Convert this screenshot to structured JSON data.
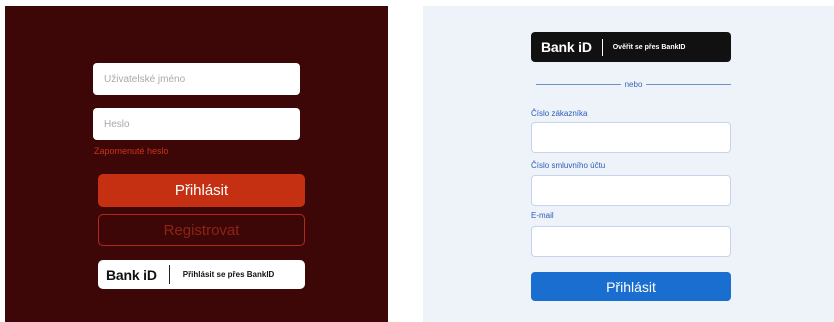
{
  "left_panel": {
    "username_placeholder": "Uživatelské jméno",
    "password_placeholder": "Heslo",
    "forgot_password": "Zapomenuté heslo",
    "login_label": "Přihlásit",
    "register_label": "Registrovat",
    "bankid_logo": "Bank iD",
    "bankid_label": "Přihlásit se přes BankID",
    "colors": {
      "background": "#3e0707",
      "primary": "#c53012"
    }
  },
  "right_panel": {
    "bankid_logo": "Bank iD",
    "bankid_label": "Ověřit se přes BankID",
    "or_text": "nebo",
    "customer_number_label": "Číslo zákazníka",
    "contract_number_label": "Číslo smluvního účtu",
    "email_label": "E-mail",
    "login_label": "Přihlásit",
    "colors": {
      "background": "#eef2f9",
      "primary": "#1a6ecf"
    }
  }
}
